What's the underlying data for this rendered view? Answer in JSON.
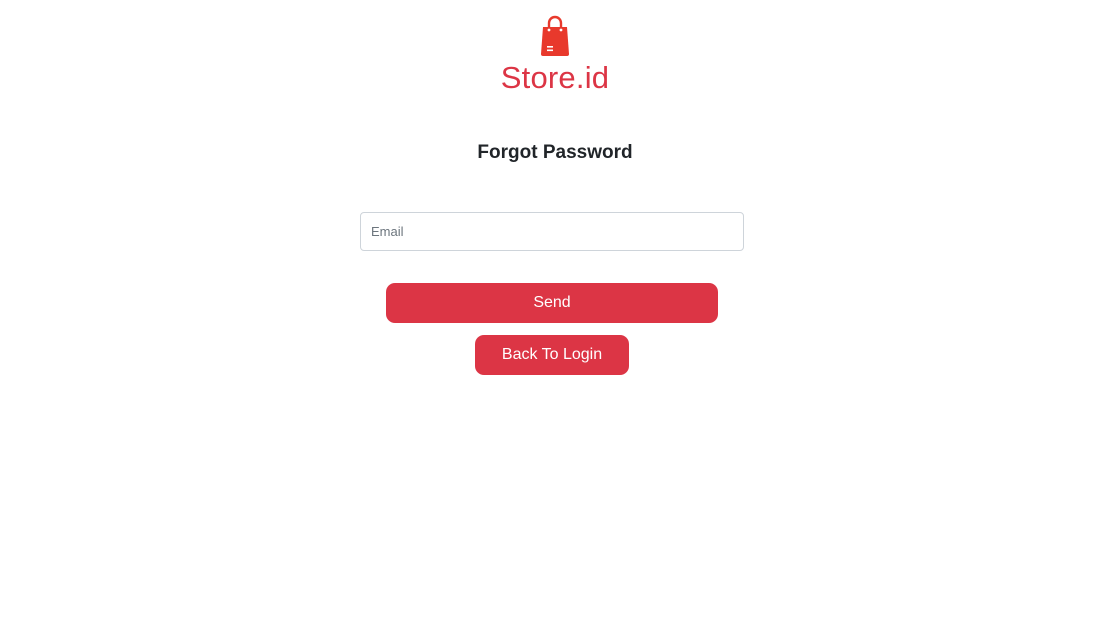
{
  "brand": {
    "name": "Store.id",
    "icon": "shopping-bag-icon",
    "color": "#dc3545"
  },
  "form": {
    "title": "Forgot Password",
    "email_placeholder": "Email",
    "email_value": ""
  },
  "buttons": {
    "send_label": "Send",
    "back_label": "Back To Login",
    "color": "#dc3545"
  }
}
